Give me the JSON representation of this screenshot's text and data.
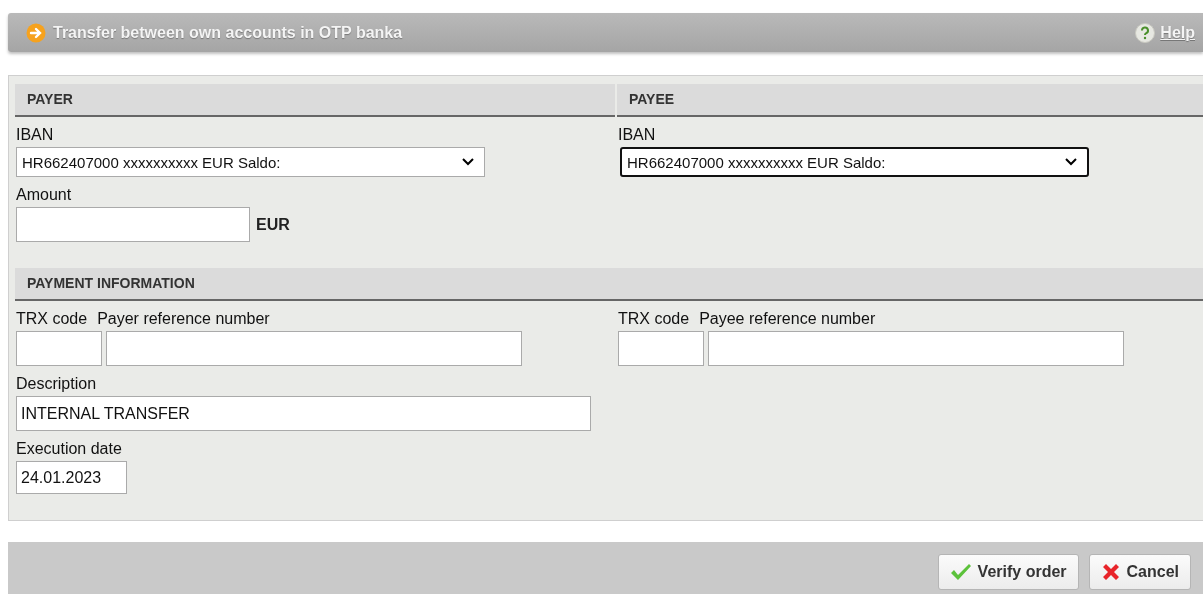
{
  "title_bar": {
    "title": "Transfer between own accounts in OTP banka",
    "help_link": "Help"
  },
  "payer": {
    "heading": "PAYER",
    "iban_label": "IBAN",
    "iban_value": "HR662407000 xxxxxxxxxx  EUR Saldo:",
    "focused": false,
    "amount_label": "Amount",
    "currency": "EUR"
  },
  "payee": {
    "heading": "PAYEE",
    "iban_label": "IBAN",
    "iban_value": "HR662407000 xxxxxxxxxx  EUR Saldo:",
    "focused": true
  },
  "payment_information": {
    "heading": "PAYMENT INFORMATION",
    "payer_side": {
      "trx_label": "TRX code",
      "ref_label": "Payer reference number"
    },
    "payee_side": {
      "trx_label": "TRX code",
      "ref_label": "Payee reference number"
    },
    "description_label": "Description",
    "description_value": "INTERNAL TRANSFER",
    "execution_date_label": "Execution date",
    "execution_date_value": "24.01.2023"
  },
  "buttons": [
    {
      "kind": "verify",
      "label": "Verify order"
    },
    {
      "kind": "cancel",
      "label": "Cancel"
    }
  ]
}
